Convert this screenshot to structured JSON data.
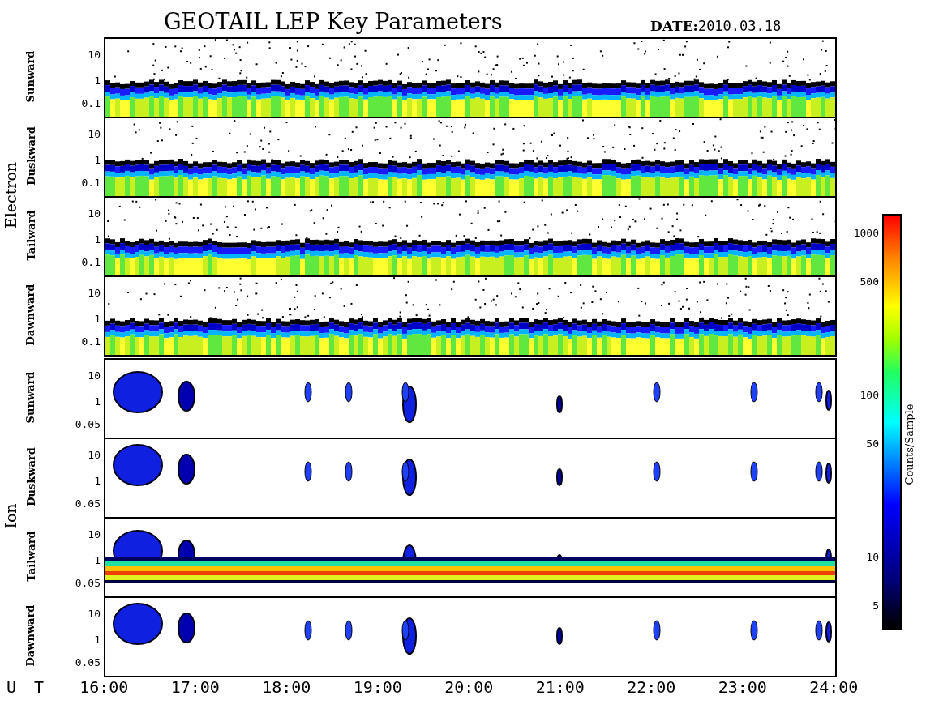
{
  "title": "GEOTAIL LEP Key Parameters",
  "date": {
    "label": "DATE:",
    "value": "2010.03.18"
  },
  "groups": [
    {
      "label": "Electron",
      "panels": [
        {
          "label": "Sunward",
          "kind": "electron",
          "yticks": [
            "10",
            "1",
            "0.1"
          ]
        },
        {
          "label": "Duskward",
          "kind": "electron",
          "yticks": [
            "10",
            "1",
            "0.1"
          ]
        },
        {
          "label": "Tailward",
          "kind": "electron",
          "yticks": [
            "10",
            "1",
            "0.1"
          ]
        },
        {
          "label": "Dawnward",
          "kind": "electron",
          "yticks": [
            "10",
            "1",
            "0.1"
          ]
        }
      ]
    },
    {
      "label": "Ion",
      "panels": [
        {
          "label": "Sunward",
          "kind": "ion",
          "yticks": [
            "10",
            "1",
            "0.05"
          ]
        },
        {
          "label": "Duskward",
          "kind": "ion",
          "yticks": [
            "10",
            "1",
            "0.05"
          ]
        },
        {
          "label": "Tailward",
          "kind": "ionband",
          "yticks": [
            "10",
            "1",
            "0.05"
          ]
        },
        {
          "label": "Dawnward",
          "kind": "ion",
          "yticks": [
            "10",
            "1",
            "0.05"
          ]
        }
      ]
    }
  ],
  "colorbar": {
    "label": "Counts/Sample",
    "ticks": [
      "1000",
      "500",
      "100",
      "50",
      "10",
      "5"
    ]
  },
  "xaxis": {
    "label": "U T",
    "ticks": [
      "16:00",
      "17:00",
      "18:00",
      "19:00",
      "20:00",
      "21:00",
      "22:00",
      "23:00",
      "24:00"
    ]
  }
}
